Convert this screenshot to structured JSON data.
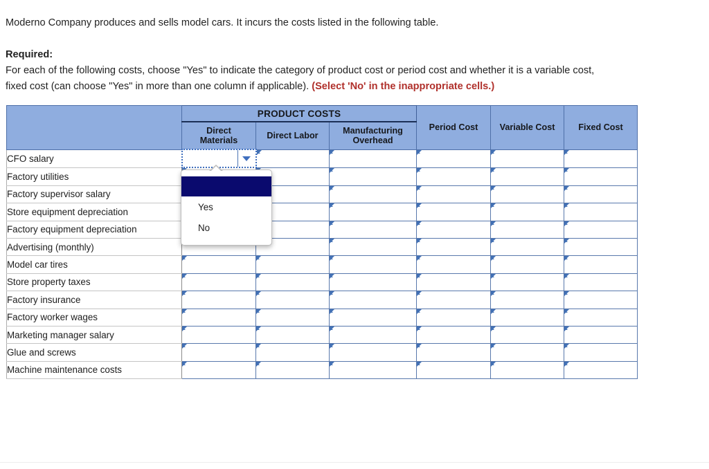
{
  "prompt": {
    "intro": "Moderno Company produces and sells model cars. It incurs the costs listed in the following table.",
    "required_label": "Required:",
    "instruction_part1": "For each of the following costs, choose \"Yes\" to indicate the category of product cost or period cost and whether it is a variable cost,",
    "instruction_part2": "fixed cost (can choose \"Yes\" in more than one column if applicable). ",
    "instruction_note": "(Select 'No' in the inappropriate cells.)",
    "note_color": "#b0302b"
  },
  "table": {
    "group_header": "PRODUCT COSTS",
    "row_header_blank": "",
    "columns": [
      "Direct Materials",
      "Direct Labor",
      "Manufacturing Overhead",
      "Period Cost",
      "Variable Cost",
      "Fixed Cost"
    ],
    "columns_multiline": [
      [
        "Direct",
        "Materials"
      ],
      [
        "Direct Labor"
      ],
      [
        "Manufacturing",
        "Overhead"
      ],
      [
        "Period Cost"
      ],
      [
        "Variable Cost"
      ],
      [
        "Fixed Cost"
      ]
    ],
    "header_bg": "#8faddf",
    "cell_border": "#5878ac",
    "rows": [
      {
        "label": "CFO salary",
        "values": [
          "",
          "",
          "",
          "",
          "",
          ""
        ]
      },
      {
        "label": "Factory utilities",
        "values": [
          "",
          "",
          "",
          "",
          "",
          ""
        ]
      },
      {
        "label": "Factory supervisor salary",
        "values": [
          "",
          "",
          "",
          "",
          "",
          ""
        ]
      },
      {
        "label": "Store equipment depreciation",
        "values": [
          "",
          "",
          "",
          "",
          "",
          ""
        ]
      },
      {
        "label": "Factory equipment depreciation",
        "values": [
          "",
          "",
          "",
          "",
          "",
          ""
        ]
      },
      {
        "label": "Advertising (monthly)",
        "values": [
          "",
          "",
          "",
          "",
          "",
          ""
        ]
      },
      {
        "label": "Model car tires",
        "values": [
          "",
          "",
          "",
          "",
          "",
          ""
        ]
      },
      {
        "label": "Store property taxes",
        "values": [
          "",
          "",
          "",
          "",
          "",
          ""
        ]
      },
      {
        "label": "Factory insurance",
        "values": [
          "",
          "",
          "",
          "",
          "",
          ""
        ]
      },
      {
        "label": "Factory worker wages",
        "values": [
          "",
          "",
          "",
          "",
          "",
          ""
        ]
      },
      {
        "label": "Marketing manager salary",
        "values": [
          "",
          "",
          "",
          "",
          "",
          ""
        ]
      },
      {
        "label": "Glue and screws",
        "values": [
          "",
          "",
          "",
          "",
          "",
          ""
        ]
      },
      {
        "label": "Machine maintenance costs",
        "values": [
          "",
          "",
          "",
          "",
          "",
          ""
        ]
      }
    ]
  },
  "active_cell": {
    "row_label": "CFO salary",
    "column": "Direct Materials",
    "value": "",
    "icon": "chevron-down-icon"
  },
  "dropdown": {
    "open": true,
    "selected_index": 0,
    "options": [
      "",
      "Yes",
      "No"
    ],
    "highlight_color": "#0a0a6e"
  }
}
